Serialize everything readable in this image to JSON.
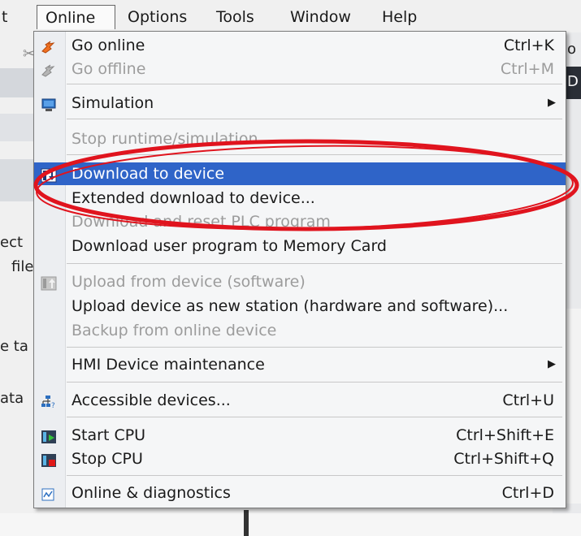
{
  "menubar": {
    "partial_left": "t",
    "items": [
      "Online",
      "Options",
      "Tools",
      "Window",
      "Help"
    ]
  },
  "background": {
    "right_top": "o",
    "right_dark": "D",
    "left_texts": [
      "ect",
      "file",
      "e ta",
      "ata"
    ]
  },
  "menu": {
    "go_online": {
      "label": "Go online",
      "shortcut": "Ctrl+K"
    },
    "go_offline": {
      "label": "Go offline",
      "shortcut": "Ctrl+M"
    },
    "simulation": {
      "label": "Simulation"
    },
    "stop_runtime": {
      "label": "Stop runtime/simulation"
    },
    "download_to_device": {
      "label": "Download to device"
    },
    "extended_download": {
      "label": "Extended download to device..."
    },
    "download_reset": {
      "label": "Download and reset PLC program"
    },
    "download_user_program": {
      "label": "Download user program to Memory Card"
    },
    "upload_from_device": {
      "label": "Upload from device (software)"
    },
    "upload_new_station": {
      "label": "Upload device as new station (hardware and software)..."
    },
    "backup_online": {
      "label": "Backup from online device"
    },
    "hmi_maintenance": {
      "label": "HMI Device maintenance"
    },
    "accessible_devices": {
      "label": "Accessible devices...",
      "shortcut": "Ctrl+U"
    },
    "start_cpu": {
      "label": "Start CPU",
      "shortcut": "Ctrl+Shift+E"
    },
    "stop_cpu": {
      "label": "Stop CPU",
      "shortcut": "Ctrl+Shift+Q"
    },
    "online_diagnostics": {
      "label": "Online & diagnostics",
      "shortcut": "Ctrl+D"
    }
  },
  "colors": {
    "highlight": "#2f64c8",
    "annotation": "#e0141e",
    "disabled_text": "#9c9c9c"
  }
}
